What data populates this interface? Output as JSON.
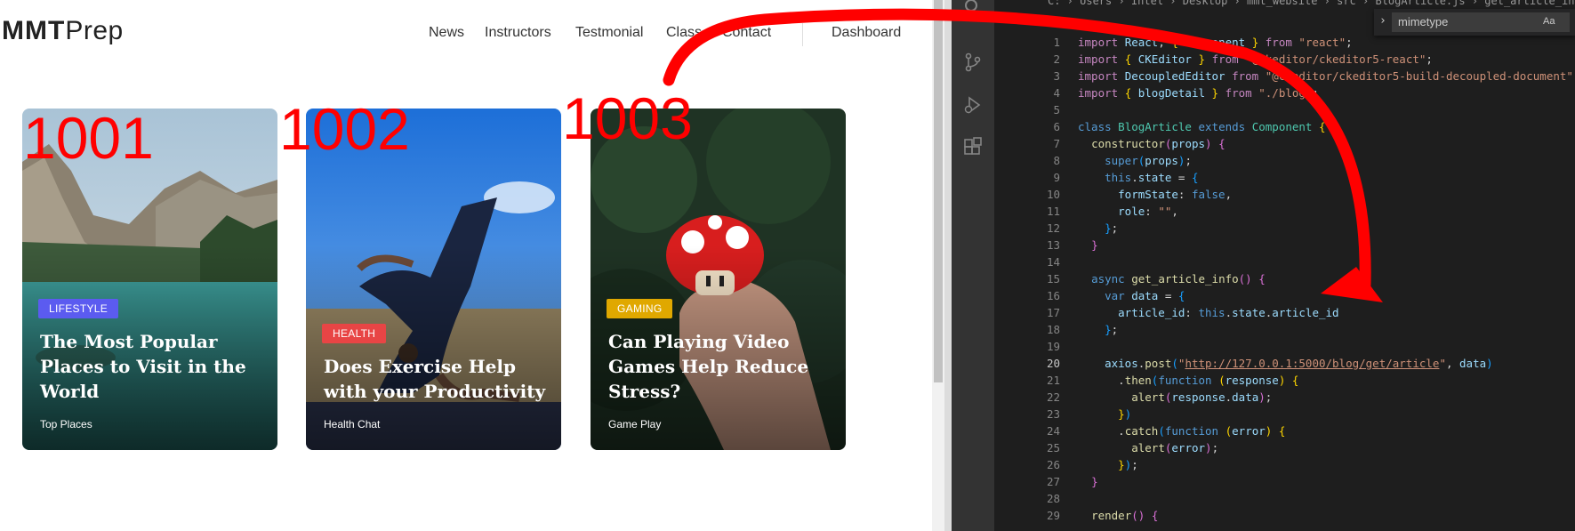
{
  "site": {
    "logo_bold": "MMT",
    "logo_rest": "Prep",
    "nav": [
      "News",
      "Instructors",
      "Testmonial",
      "Class",
      "Contact",
      "Dashboard"
    ],
    "cards": [
      {
        "annotation": "1001",
        "badge": "LIFESTYLE",
        "badge_color": "#5b5bf0",
        "title": "The Most Popular Places to Visit in the World",
        "sub": "Top Places"
      },
      {
        "annotation": "1002",
        "badge": "HEALTH",
        "badge_color": "#e84545",
        "title": "Does Exercise Help with your Productivity",
        "sub": "Health Chat"
      },
      {
        "annotation": "1003",
        "badge": "GAMING",
        "badge_color": "#e0a800",
        "title": "Can Playing Video Games Help Reduce Stress?",
        "sub": "Game Play"
      }
    ]
  },
  "editor": {
    "breadcrumb": "C: › Users › Intel › Desktop › mmt_website › src › BlogArticle.js › get_article_info",
    "find_query": "mimetype",
    "find_opt": "Aa ab",
    "lines": [
      {
        "n": "1",
        "html": "<span class='k'>import</span> <span class='v'>React</span>, <span class='br'>{</span> <span class='v'>Component</span> <span class='br'>}</span> <span class='k'>from</span> <span class='s'>\"react\"</span>;"
      },
      {
        "n": "2",
        "html": "<span class='k'>import</span> <span class='br'>{</span> <span class='v'>CKEditor</span> <span class='br'>}</span> <span class='k'>from</span> <span class='s'>\"@ckeditor/ckeditor5-react\"</span>;"
      },
      {
        "n": "3",
        "html": "<span class='k'>import</span> <span class='v'>DecoupledEditor</span> <span class='k'>from</span> <span class='s'>\"@ckeditor/ckeditor5-build-decoupled-document\"</span>;"
      },
      {
        "n": "4",
        "html": "<span class='k'>import</span> <span class='br'>{</span> <span class='v'>blogDetail</span> <span class='br'>}</span> <span class='k'>from</span> <span class='s'>\"./blog\"</span>;"
      },
      {
        "n": "5",
        "html": ""
      },
      {
        "n": "6",
        "html": "<span class='kb'>class</span> <span class='cls'>BlogArticle</span> <span class='kb'>extends</span> <span class='cls'>Component</span> <span class='br'>{</span>"
      },
      {
        "n": "7",
        "html": "  <span class='fn'>constructor</span><span class='br2'>(</span><span class='v'>props</span><span class='br2'>)</span> <span class='br2'>{</span>"
      },
      {
        "n": "8",
        "html": "    <span class='kb'>super</span><span class='br3'>(</span><span class='v'>props</span><span class='br3'>)</span>;"
      },
      {
        "n": "9",
        "html": "    <span class='kb'>this</span>.<span class='v'>state</span> = <span class='br3'>{</span>"
      },
      {
        "n": "10",
        "html": "      <span class='v'>formState</span>: <span class='kb'>false</span>,"
      },
      {
        "n": "11",
        "html": "      <span class='v'>role</span>: <span class='s'>\"\"</span>,"
      },
      {
        "n": "12",
        "html": "    <span class='br3'>}</span>;"
      },
      {
        "n": "13",
        "html": "  <span class='br2'>}</span>"
      },
      {
        "n": "14",
        "html": ""
      },
      {
        "n": "15",
        "html": "  <span class='kb'>async</span> <span class='fn'>get_article_info</span><span class='br2'>()</span> <span class='br2'>{</span>"
      },
      {
        "n": "16",
        "html": "    <span class='kb'>var</span> <span class='v'>data</span> = <span class='br3'>{</span>"
      },
      {
        "n": "17",
        "html": "      <span class='v'>article_id</span>: <span class='kb'>this</span>.<span class='v'>state</span>.<span class='v'>article_id</span>"
      },
      {
        "n": "18",
        "html": "    <span class='br3'>}</span>;"
      },
      {
        "n": "19",
        "html": ""
      },
      {
        "n": "20",
        "html": "    <span class='v'>axios</span>.<span class='fn'>post</span><span class='br3'>(</span><span class='s'>\"<span class='u'>http://127.0.0.1:5000/blog/get/article</span>\"</span>, <span class='v'>data</span><span class='br3'>)</span>"
      },
      {
        "n": "21",
        "html": "      .<span class='fn'>then</span><span class='br3'>(</span><span class='kb'>function</span> <span class='br'>(</span><span class='v'>response</span><span class='br'>)</span> <span class='br'>{</span>"
      },
      {
        "n": "22",
        "html": "        <span class='fn'>alert</span><span class='br2'>(</span><span class='v'>response</span>.<span class='v'>data</span><span class='br2'>)</span>;"
      },
      {
        "n": "23",
        "html": "      <span class='br'>}</span><span class='br3'>)</span>"
      },
      {
        "n": "24",
        "html": "      .<span class='fn'>catch</span><span class='br3'>(</span><span class='kb'>function</span> <span class='br'>(</span><span class='v'>error</span><span class='br'>)</span> <span class='br'>{</span>"
      },
      {
        "n": "25",
        "html": "        <span class='fn'>alert</span><span class='br2'>(</span><span class='v'>error</span><span class='br2'>)</span>;"
      },
      {
        "n": "26",
        "html": "      <span class='br'>}</span><span class='br3'>)</span>;"
      },
      {
        "n": "27",
        "html": "  <span class='br2'>}</span>"
      },
      {
        "n": "28",
        "html": ""
      },
      {
        "n": "29",
        "html": "  <span class='fn'>render</span><span class='br2'>()</span> <span class='br2'>{</span>"
      }
    ],
    "active_line": "20"
  }
}
